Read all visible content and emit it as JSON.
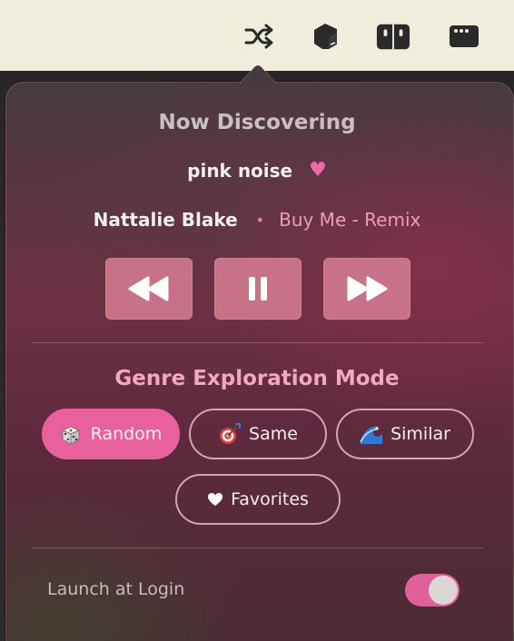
{
  "menubar": {
    "icons": [
      "shuffle-icon",
      "graduation-cap-icon",
      "reader-icon",
      "window-icon"
    ]
  },
  "popover": {
    "title": "Now Discovering",
    "track": {
      "name": "pink noise",
      "favorite_glyph": "♥",
      "artist": "Nattalie Blake",
      "separator": "•",
      "song": "Buy Me - Remix"
    },
    "controls": [
      "rewind-icon",
      "pause-icon",
      "fast-forward-icon"
    ],
    "genre_section": {
      "title": "Genre Exploration Mode",
      "modes": [
        {
          "label": "Random",
          "icon": "dice-icon",
          "selected": true
        },
        {
          "label": "Same",
          "icon": "target-icon",
          "selected": false
        },
        {
          "label": "Similar",
          "icon": "wave-icon",
          "selected": false
        },
        {
          "label": "Favorites",
          "icon": "heart-icon",
          "selected": false
        }
      ]
    },
    "launch_at_login": {
      "label": "Launch at Login",
      "enabled": true
    }
  },
  "colors": {
    "accent": "#e8609c",
    "section_title": "#f2a7c2",
    "song_link": "#ec9cbb",
    "menubar": "#f1eddd"
  }
}
